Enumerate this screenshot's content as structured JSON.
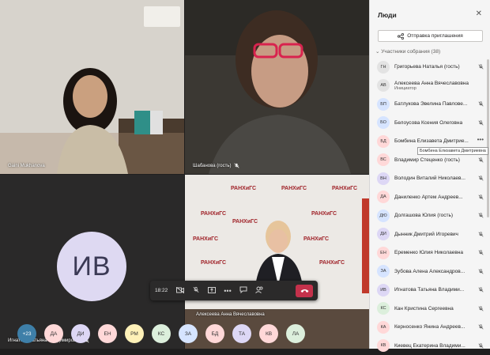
{
  "tiles": [
    {
      "name": "Gaini Mukhanova",
      "muted": false
    },
    {
      "name": "Шабанова (гость)",
      "muted": true
    },
    {
      "name": "Игнатова Татьяна Владимировна",
      "initials": "ИВ",
      "muted": true
    },
    {
      "name": "Алексеева Анна Вячеславовна",
      "muted": false
    }
  ],
  "banner_text": "РАНХиГС",
  "callbar": {
    "time": "18:22"
  },
  "bubbles": [
    {
      "label": "+23",
      "color": "#3e7fa8",
      "text_color": "#ffffff"
    },
    {
      "label": "ДА",
      "color": "#ffd8d8"
    },
    {
      "label": "ДИ",
      "color": "#ddd7f5"
    },
    {
      "label": "ЕН",
      "color": "#ffd8d8"
    },
    {
      "label": "РМ",
      "color": "#fff1b8"
    },
    {
      "label": "КС",
      "color": "#dcefdc"
    },
    {
      "label": "ЗА",
      "color": "#d6e4ff"
    },
    {
      "label": "БД",
      "color": "#ffd8d8"
    },
    {
      "label": "ТА",
      "color": "#ddd7f5"
    },
    {
      "label": "КВ",
      "color": "#ffd8d8"
    },
    {
      "label": "ЛА",
      "color": "#dcefdc"
    }
  ],
  "panel": {
    "title": "Люди",
    "invite_label": "Отправка приглашения",
    "section_label": "Участники собрания (38)",
    "tooltip": "Бомбина Елизавета Дмитриевна",
    "participants": [
      {
        "initials": "ГН",
        "name": "Григорьева Наталья (гость)",
        "color": "#e3e3e3",
        "muted": true
      },
      {
        "initials": "АВ",
        "name": "Алексеева Анна Вячеславовна",
        "role": "Инициатор",
        "color": "#e3e3e3",
        "muted": false
      },
      {
        "initials": "БП",
        "name": "Батлукова Эвелина Павлове...",
        "color": "#d6e4ff",
        "muted": true
      },
      {
        "initials": "БО",
        "name": "Белоусова Ксения Олеговна",
        "color": "#d6e4ff",
        "muted": true
      },
      {
        "initials": "БД",
        "name": "Бомбина Елизавета Дмитрие...",
        "color": "#ffd8d8",
        "muted": false,
        "more": true
      },
      {
        "initials": "ВС",
        "name": "Владимир Стеценко (гость)",
        "color": "#ffd8d8",
        "muted": true
      },
      {
        "initials": "ВН",
        "name": "Володин Виталий Николаев...",
        "color": "#ddd7f5",
        "muted": true
      },
      {
        "initials": "ДА",
        "name": "Даниленко Артем Андреев...",
        "color": "#ffd8d8",
        "muted": true
      },
      {
        "initials": "ДЮ",
        "name": "Долгашова Юлия (гость)",
        "color": "#d6e4ff",
        "muted": true
      },
      {
        "initials": "ДИ",
        "name": "Дынник Дмитрий Игоревич",
        "color": "#ddd7f5",
        "muted": true
      },
      {
        "initials": "ЕН",
        "name": "Еременко Юлия Николаевна",
        "color": "#ffd8d8",
        "muted": true
      },
      {
        "initials": "ЗА",
        "name": "Зубова Алена Александров...",
        "color": "#d6e4ff",
        "muted": true
      },
      {
        "initials": "ИВ",
        "name": "Игнатова Татьяна Владими...",
        "color": "#ddd7f5",
        "muted": true
      },
      {
        "initials": "КС",
        "name": "Кан Кристина Сергеевна",
        "color": "#dcefdc",
        "muted": true
      },
      {
        "initials": "КА",
        "name": "Керносенко Янина Андреев...",
        "color": "#ffd8d8",
        "muted": true
      },
      {
        "initials": "КВ",
        "name": "Киевец Екатерина Владими...",
        "color": "#ffd8d8",
        "muted": true
      }
    ]
  }
}
